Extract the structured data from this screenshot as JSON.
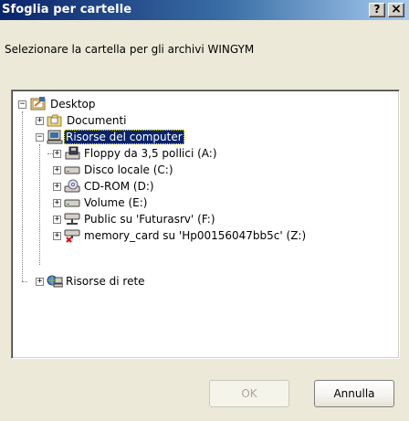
{
  "dialog": {
    "title": "Sfoglia per cartelle",
    "help_button": "?",
    "close_button": "×",
    "prompt": "Selezionare la cartella per gli archivi WINGYM"
  },
  "tree": {
    "items": [
      {
        "label": "Desktop",
        "icon": "desktop-icon",
        "expander": "−"
      },
      {
        "label": "Documenti",
        "icon": "documents-folder-icon",
        "expander": "+"
      },
      {
        "label": "Risorse del computer",
        "icon": "my-computer-icon",
        "expander": "−",
        "selected": true
      },
      {
        "label": "Floppy da 3,5 pollici (A:)",
        "icon": "floppy-drive-icon",
        "expander": "+"
      },
      {
        "label": "Disco locale (C:)",
        "icon": "hard-drive-icon",
        "expander": "+"
      },
      {
        "label": "CD-ROM (D:)",
        "icon": "cdrom-drive-icon",
        "expander": "+"
      },
      {
        "label": "Volume (E:)",
        "icon": "hard-drive-icon",
        "expander": "+"
      },
      {
        "label": "Public su 'Futurasrv' (F:)",
        "icon": "network-drive-icon",
        "expander": "+"
      },
      {
        "label": "memory_card su 'Hp00156047bb5c' (Z:)",
        "icon": "disconnected-network-drive-icon",
        "expander": "+"
      },
      {
        "label": "Risorse di rete",
        "icon": "network-places-icon",
        "expander": "+"
      }
    ]
  },
  "buttons": {
    "ok": "OK",
    "cancel": "Annulla"
  }
}
